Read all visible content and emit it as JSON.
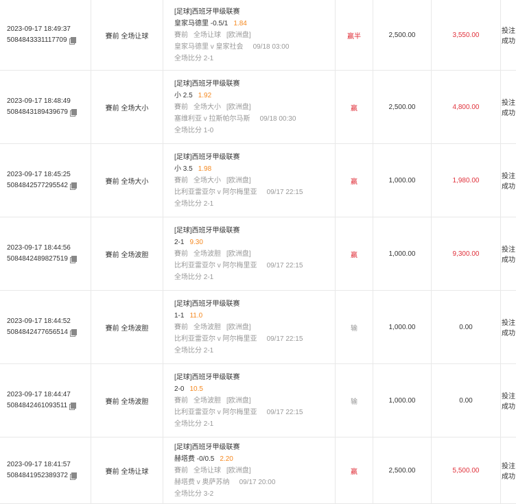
{
  "rows": [
    {
      "time": "2023-09-17 18:49:37",
      "id": "5084843331117709",
      "bet_type": "賽前 全场让球",
      "league": "[足球]西班牙甲级联赛",
      "selection": "皇家马德里 -0.5/1",
      "odds": "1.84",
      "market": "賽前",
      "market2": "全场让球",
      "odds_format": "[欧洲盘]",
      "teams": "皇家马德里 v 皇家社会",
      "kickoff": "09/18 03:00",
      "score": "全场比分 2-1",
      "result": "赢半",
      "result_type": "win",
      "stake": "2,500.00",
      "payout": "3,550.00",
      "payout_type": "red",
      "status": "投注成功"
    },
    {
      "time": "2023-09-17 18:48:49",
      "id": "5084843189439679",
      "bet_type": "賽前 全场大小",
      "league": "[足球]西班牙甲级联赛",
      "selection": "小 2.5",
      "odds": "1.92",
      "market": "賽前",
      "market2": "全场大小",
      "odds_format": "[欧洲盘]",
      "teams": "塞维利亚 v 拉斯帕尔马斯",
      "kickoff": "09/18 00:30",
      "score": "全场比分 1-0",
      "result": "赢",
      "result_type": "win",
      "stake": "2,500.00",
      "payout": "4,800.00",
      "payout_type": "red",
      "status": "投注成功"
    },
    {
      "time": "2023-09-17 18:45:25",
      "id": "5084842577295542",
      "bet_type": "賽前 全场大小",
      "league": "[足球]西班牙甲级联赛",
      "selection": "小 3.5",
      "odds": "1.98",
      "market": "賽前",
      "market2": "全场大小",
      "odds_format": "[欧洲盘]",
      "teams": "比利亚雷亚尔 v 阿尔梅里亚",
      "kickoff": "09/17 22:15",
      "score": "全场比分 2-1",
      "result": "赢",
      "result_type": "win",
      "stake": "1,000.00",
      "payout": "1,980.00",
      "payout_type": "red",
      "status": "投注成功"
    },
    {
      "time": "2023-09-17 18:44:56",
      "id": "5084842489827519",
      "bet_type": "賽前 全场波胆",
      "league": "[足球]西班牙甲级联赛",
      "selection": "2-1",
      "odds": "9.30",
      "market": "賽前",
      "market2": "全场波胆",
      "odds_format": "[欧洲盘]",
      "teams": "比利亚雷亚尔 v 阿尔梅里亚",
      "kickoff": "09/17 22:15",
      "score": "全场比分 2-1",
      "result": "赢",
      "result_type": "win",
      "stake": "1,000.00",
      "payout": "9,300.00",
      "payout_type": "red",
      "status": "投注成功"
    },
    {
      "time": "2023-09-17 18:44:52",
      "id": "5084842477656514",
      "bet_type": "賽前 全场波胆",
      "league": "[足球]西班牙甲级联赛",
      "selection": "1-1",
      "odds": "11.0",
      "market": "賽前",
      "market2": "全场波胆",
      "odds_format": "[欧洲盘]",
      "teams": "比利亚雷亚尔 v 阿尔梅里亚",
      "kickoff": "09/17 22:15",
      "score": "全场比分 2-1",
      "result": "输",
      "result_type": "lose",
      "stake": "1,000.00",
      "payout": "0.00",
      "payout_type": "plain",
      "status": "投注成功"
    },
    {
      "time": "2023-09-17 18:44:47",
      "id": "5084842461093511",
      "bet_type": "賽前 全场波胆",
      "league": "[足球]西班牙甲级联赛",
      "selection": "2-0",
      "odds": "10.5",
      "market": "賽前",
      "market2": "全场波胆",
      "odds_format": "[欧洲盘]",
      "teams": "比利亚雷亚尔 v 阿尔梅里亚",
      "kickoff": "09/17 22:15",
      "score": "全场比分 2-1",
      "result": "输",
      "result_type": "lose",
      "stake": "1,000.00",
      "payout": "0.00",
      "payout_type": "plain",
      "status": "投注成功"
    },
    {
      "time": "2023-09-17 18:41:57",
      "id": "5084841952389372",
      "bet_type": "賽前 全场让球",
      "league": "[足球]西班牙甲级联赛",
      "selection": "赫塔费 -0/0.5",
      "odds": "2.20",
      "market": "賽前",
      "market2": "全场让球",
      "odds_format": "[欧洲盘]",
      "teams": "赫塔费 v 奥萨苏纳",
      "kickoff": "09/17 20:00",
      "score": "全场比分 3-2",
      "result": "赢",
      "result_type": "win",
      "stake": "2,500.00",
      "payout": "5,500.00",
      "payout_type": "red",
      "status": "投注成功"
    }
  ],
  "colors": {
    "win": "#e0313b",
    "odds": "#f5881f",
    "muted": "#999999",
    "border": "#e8e8e8"
  }
}
